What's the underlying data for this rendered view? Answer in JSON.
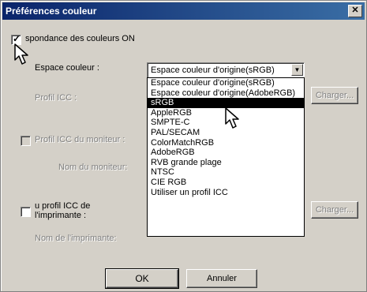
{
  "window": {
    "title": "Préférences couleur"
  },
  "main_checkbox": {
    "label": "spondance des couleurs ON",
    "checked": true
  },
  "color_space": {
    "label": "Espace couleur :",
    "selected_value": "Espace couleur d'origine(sRGB)",
    "options": [
      "Espace couleur d'origine(sRGB)",
      "Espace couleur d'origine(AdobeRGB)",
      "sRGB",
      "AppleRGB",
      "SMPTE-C",
      "PAL/SECAM",
      "ColorMatchRGB",
      "AdobeRGB",
      "RVB grande plage",
      "NTSC",
      "CIE RGB",
      "Utiliser un profil ICC"
    ],
    "highlighted_option": "sRGB"
  },
  "icc_profile": {
    "label": "Profil ICC :",
    "button": "Charger..."
  },
  "monitor_profile": {
    "checkbox_label": "Profil ICC du moniteur :",
    "name_label": "Nom du moniteur:"
  },
  "printer_profile": {
    "checkbox_label_line1": "u profil ICC de",
    "checkbox_label_line2": "l'imprimante :",
    "button": "Charger...",
    "name_label": "Nom de l'imprimante:"
  },
  "footer": {
    "ok": "OK",
    "cancel": "Annuler"
  },
  "colors": {
    "titlebar": "#0a246a",
    "face": "#d4d0c8",
    "highlight": "#000000"
  },
  "icons": {
    "cursor": "arrow-pointer",
    "close": "close-icon"
  }
}
